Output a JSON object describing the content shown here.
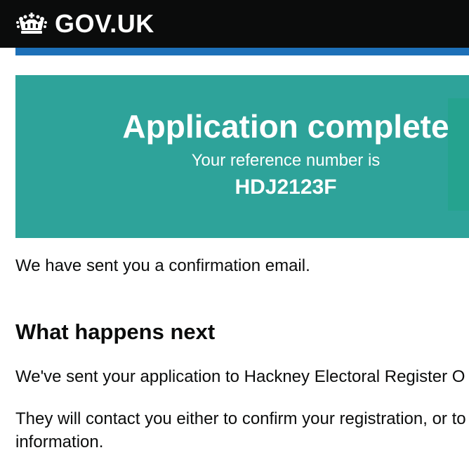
{
  "header": {
    "logo_text": "GOV.UK",
    "logo_icon": "crown-icon",
    "background_color": "#0b0c0c",
    "strip_color": "#1d70b8"
  },
  "panel": {
    "title": "Application complete",
    "subtitle": "Your reference number is",
    "reference": "HDJ2123F",
    "background_color": "#2ea39a"
  },
  "content": {
    "confirmation": "We have sent you a confirmation email.",
    "heading": "What happens next",
    "paragraph1": "We've sent your application to Hackney Electoral Register O",
    "paragraph2": "They will contact you either to confirm your registration, or to information."
  }
}
